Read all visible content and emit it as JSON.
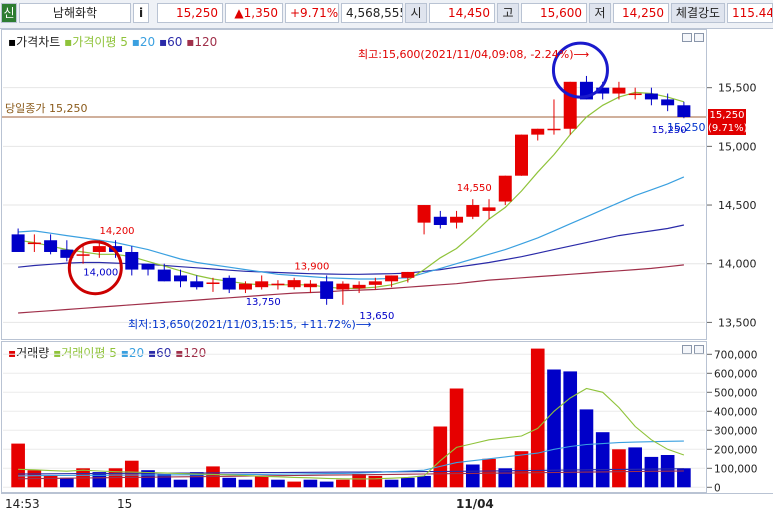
{
  "header": {
    "market_badge": "신",
    "stock_name": "남해화학",
    "info_button": "i",
    "price": "15,250",
    "change": "▲1,350",
    "change_pct": "+9.71%",
    "volume": "4,568,555",
    "open_label": "시",
    "open": "14,450",
    "high_label": "고",
    "high": "15,600",
    "low_label": "저",
    "low": "14,250",
    "strength_label": "체결강도",
    "strength": "115.44"
  },
  "price_panel": {
    "legend_title": "가격차트",
    "legend_ma": "가격이평 5",
    "legend_ma20": "20",
    "legend_ma60": "60",
    "legend_ma120": "120",
    "prev_close_label": "당일종가 15,250",
    "high_note": "최고:15,600(2021/11/04,09:08, -2.24%)⟶",
    "low_note": "최저:13,650(2021/11/03,15:15, +11.72%)⟶",
    "current_price_label": "15,250",
    "current_pct_label": "(9.71%)",
    "last_value_label": "15,250"
  },
  "volume_panel": {
    "legend_title": "거래량",
    "legend_ma": "거래이평 5",
    "legend_ma20": "20",
    "legend_ma60": "60",
    "legend_ma120": "120"
  },
  "x_axis": {
    "labels": [
      "14:53",
      "15",
      "11/04"
    ]
  },
  "colors": {
    "up": "#e60000",
    "down": "#0000c8",
    "ma5": "#8fc33a",
    "ma20": "#3aa0e0",
    "ma60": "#2a2aa8",
    "ma120": "#a0304a",
    "highlight_circle_red": "#cc0000",
    "highlight_circle_blue": "#1a1acc"
  },
  "chart_data": [
    {
      "type": "candlestick",
      "title": "가격차트",
      "y_ticks": [
        13500,
        14000,
        14500,
        15000,
        15500
      ],
      "ylim": [
        13350,
        16000
      ],
      "candles": [
        {
          "o": 14250,
          "h": 14300,
          "l": 14100,
          "c": 14100
        },
        {
          "o": 14180,
          "h": 14250,
          "l": 14100,
          "c": 14180
        },
        {
          "o": 14200,
          "h": 14250,
          "l": 14080,
          "c": 14100
        },
        {
          "o": 14120,
          "h": 14200,
          "l": 14020,
          "c": 14050
        },
        {
          "o": 14080,
          "h": 14150,
          "l": 14000,
          "c": 14080
        },
        {
          "o": 14100,
          "h": 14200,
          "l": 14050,
          "c": 14150
        },
        {
          "o": 14150,
          "h": 14200,
          "l": 14050,
          "c": 14100
        },
        {
          "o": 14100,
          "h": 14150,
          "l": 13900,
          "c": 13950
        },
        {
          "o": 14000,
          "h": 14000,
          "l": 13900,
          "c": 13950
        },
        {
          "o": 13950,
          "h": 14000,
          "l": 13850,
          "c": 13850
        },
        {
          "o": 13900,
          "h": 13950,
          "l": 13800,
          "c": 13850
        },
        {
          "o": 13850,
          "h": 13900,
          "l": 13780,
          "c": 13800
        },
        {
          "o": 13830,
          "h": 13880,
          "l": 13760,
          "c": 13840
        },
        {
          "o": 13880,
          "h": 13900,
          "l": 13750,
          "c": 13780
        },
        {
          "o": 13780,
          "h": 13850,
          "l": 13750,
          "c": 13830
        },
        {
          "o": 13800,
          "h": 13900,
          "l": 13780,
          "c": 13850
        },
        {
          "o": 13820,
          "h": 13860,
          "l": 13780,
          "c": 13830
        },
        {
          "o": 13800,
          "h": 13880,
          "l": 13780,
          "c": 13860
        },
        {
          "o": 13800,
          "h": 13860,
          "l": 13750,
          "c": 13830
        },
        {
          "o": 13850,
          "h": 13900,
          "l": 13650,
          "c": 13700
        },
        {
          "o": 13780,
          "h": 13850,
          "l": 13650,
          "c": 13830
        },
        {
          "o": 13790,
          "h": 13850,
          "l": 13750,
          "c": 13820
        },
        {
          "o": 13820,
          "h": 13880,
          "l": 13780,
          "c": 13850
        },
        {
          "o": 13850,
          "h": 13900,
          "l": 13800,
          "c": 13900
        },
        {
          "o": 13880,
          "h": 13930,
          "l": 13840,
          "c": 13930
        },
        {
          "o": 14350,
          "h": 14500,
          "l": 14250,
          "c": 14500
        },
        {
          "o": 14400,
          "h": 14450,
          "l": 14300,
          "c": 14330
        },
        {
          "o": 14350,
          "h": 14450,
          "l": 14300,
          "c": 14400
        },
        {
          "o": 14400,
          "h": 14550,
          "l": 14380,
          "c": 14500
        },
        {
          "o": 14450,
          "h": 14550,
          "l": 14380,
          "c": 14480
        },
        {
          "o": 14530,
          "h": 14750,
          "l": 14500,
          "c": 14750
        },
        {
          "o": 14750,
          "h": 15100,
          "l": 14750,
          "c": 15100
        },
        {
          "o": 15100,
          "h": 15150,
          "l": 15050,
          "c": 15150
        },
        {
          "o": 15150,
          "h": 15400,
          "l": 15100,
          "c": 15150
        },
        {
          "o": 15150,
          "h": 15550,
          "l": 15100,
          "c": 15550
        },
        {
          "o": 15550,
          "h": 15600,
          "l": 15400,
          "c": 15400
        },
        {
          "o": 15500,
          "h": 15550,
          "l": 15400,
          "c": 15450
        },
        {
          "o": 15450,
          "h": 15550,
          "l": 15400,
          "c": 15500
        },
        {
          "o": 15450,
          "h": 15500,
          "l": 15400,
          "c": 15450
        },
        {
          "o": 15450,
          "h": 15500,
          "l": 15350,
          "c": 15400
        },
        {
          "o": 15400,
          "h": 15450,
          "l": 15300,
          "c": 15350
        },
        {
          "o": 15350,
          "h": 15380,
          "l": 15240,
          "c": 15250
        }
      ],
      "ma5": [
        14200,
        14180,
        14150,
        14120,
        14100,
        14080,
        14080,
        14060,
        14020,
        13980,
        13940,
        13900,
        13870,
        13850,
        13830,
        13820,
        13820,
        13820,
        13820,
        13800,
        13790,
        13790,
        13800,
        13820,
        13860,
        13950,
        14050,
        14130,
        14250,
        14380,
        14480,
        14620,
        14780,
        14930,
        15100,
        15250,
        15350,
        15420,
        15460,
        15450,
        15420,
        15380
      ],
      "ma20": [
        14270,
        14280,
        14260,
        14240,
        14220,
        14200,
        14180,
        14150,
        14120,
        14080,
        14040,
        14010,
        13990,
        13970,
        13950,
        13930,
        13910,
        13900,
        13890,
        13880,
        13875,
        13870,
        13870,
        13875,
        13880,
        13920,
        13960,
        14000,
        14040,
        14080,
        14120,
        14170,
        14220,
        14280,
        14340,
        14400,
        14460,
        14520,
        14580,
        14630,
        14680,
        14740
      ],
      "ma60": [
        13970,
        13985,
        13995,
        14005,
        14010,
        14010,
        14005,
        14000,
        13995,
        13985,
        13975,
        13965,
        13955,
        13945,
        13935,
        13930,
        13925,
        13920,
        13915,
        13912,
        13910,
        13910,
        13912,
        13915,
        13920,
        13935,
        13950,
        13970,
        13990,
        14010,
        14035,
        14060,
        14090,
        14120,
        14150,
        14180,
        14210,
        14240,
        14260,
        14280,
        14300,
        14330
      ],
      "ma120": [
        13580,
        13590,
        13600,
        13610,
        13620,
        13630,
        13640,
        13650,
        13660,
        13670,
        13680,
        13690,
        13700,
        13710,
        13720,
        13730,
        13740,
        13750,
        13755,
        13760,
        13770,
        13775,
        13780,
        13790,
        13800,
        13810,
        13820,
        13830,
        13845,
        13860,
        13870,
        13880,
        13890,
        13900,
        13910,
        13920,
        13930,
        13940,
        13950,
        13960,
        13975,
        13990
      ],
      "annotations": [
        {
          "label": "14,200",
          "value": 14200
        },
        {
          "label": "14,000",
          "value": 14000
        },
        {
          "label": "13,750",
          "value": 13750
        },
        {
          "label": "13,900",
          "value": 13900
        },
        {
          "label": "13,650",
          "value": 13650
        },
        {
          "label": "14,550",
          "value": 14550
        },
        {
          "label": "15,250",
          "value": 15250
        }
      ]
    },
    {
      "type": "bar",
      "title": "거래량",
      "y_ticks": [
        0,
        100000,
        200000,
        300000,
        400000,
        500000,
        600000,
        700000
      ],
      "y_tick_labels": [
        "0",
        "100,000",
        "200,000",
        "300,000",
        "400,000",
        "500,000",
        "600,000",
        "700,000"
      ],
      "ylim": [
        -30000,
        770000
      ],
      "values": [
        230000,
        90000,
        60000,
        50000,
        100000,
        80000,
        100000,
        140000,
        90000,
        70000,
        40000,
        80000,
        110000,
        50000,
        40000,
        60000,
        40000,
        30000,
        40000,
        30000,
        40000,
        70000,
        60000,
        40000,
        50000,
        60000,
        320000,
        520000,
        120000,
        150000,
        100000,
        190000,
        730000,
        620000,
        610000,
        410000,
        290000,
        200000,
        210000,
        160000,
        170000,
        100000
      ],
      "up": [
        true,
        true,
        true,
        false,
        true,
        false,
        true,
        true,
        false,
        false,
        false,
        false,
        true,
        false,
        false,
        true,
        false,
        true,
        false,
        false,
        true,
        true,
        true,
        false,
        false,
        false,
        true,
        true,
        false,
        true,
        false,
        true,
        true,
        false,
        false,
        false,
        false,
        true,
        false,
        false,
        false,
        false
      ],
      "ma5": [
        95000,
        92000,
        88000,
        85000,
        90000,
        86000,
        82000,
        80000,
        78000,
        76000,
        72000,
        70000,
        68000,
        65000,
        62000,
        58000,
        55000,
        52000,
        50000,
        47000,
        45000,
        44000,
        45000,
        48000,
        52000,
        60000,
        140000,
        210000,
        230000,
        250000,
        260000,
        270000,
        310000,
        400000,
        470000,
        520000,
        500000,
        420000,
        320000,
        250000,
        200000,
        170000
      ],
      "ma20": [
        60000,
        61000,
        62000,
        62000,
        63000,
        63000,
        64000,
        64000,
        65000,
        65000,
        66000,
        66000,
        67000,
        67000,
        68000,
        68000,
        69000,
        70000,
        71000,
        72000,
        73000,
        75000,
        78000,
        82000,
        86000,
        90000,
        110000,
        130000,
        140000,
        150000,
        160000,
        170000,
        180000,
        200000,
        215000,
        225000,
        230000,
        235000,
        238000,
        240000,
        242000,
        243000
      ],
      "ma60": [
        70000,
        70500,
        71000,
        71500,
        72000,
        72500,
        73000,
        73500,
        74000,
        74500,
        75000,
        75500,
        76000,
        76500,
        77000,
        77500,
        78000,
        78500,
        79000,
        79500,
        80000,
        80500,
        81000,
        81500,
        82000,
        82500,
        83000,
        84000,
        85000,
        86000,
        87000,
        88000,
        89000,
        90000,
        91000,
        92000,
        93000,
        94000,
        95000,
        96000,
        97000,
        98000
      ],
      "ma120": [
        45000,
        46000,
        47000,
        48000,
        49000,
        50000,
        51000,
        52000,
        53000,
        54000,
        55000,
        56000,
        57000,
        58000,
        59000,
        60000,
        61000,
        62000,
        63000,
        64000,
        65000,
        66000,
        67000,
        68000,
        69000,
        70000,
        71000,
        72000,
        73000,
        74000,
        75000,
        76000,
        77000,
        78000,
        79000,
        80000,
        81000,
        82000,
        83000,
        84000,
        85000,
        86000
      ]
    }
  ]
}
